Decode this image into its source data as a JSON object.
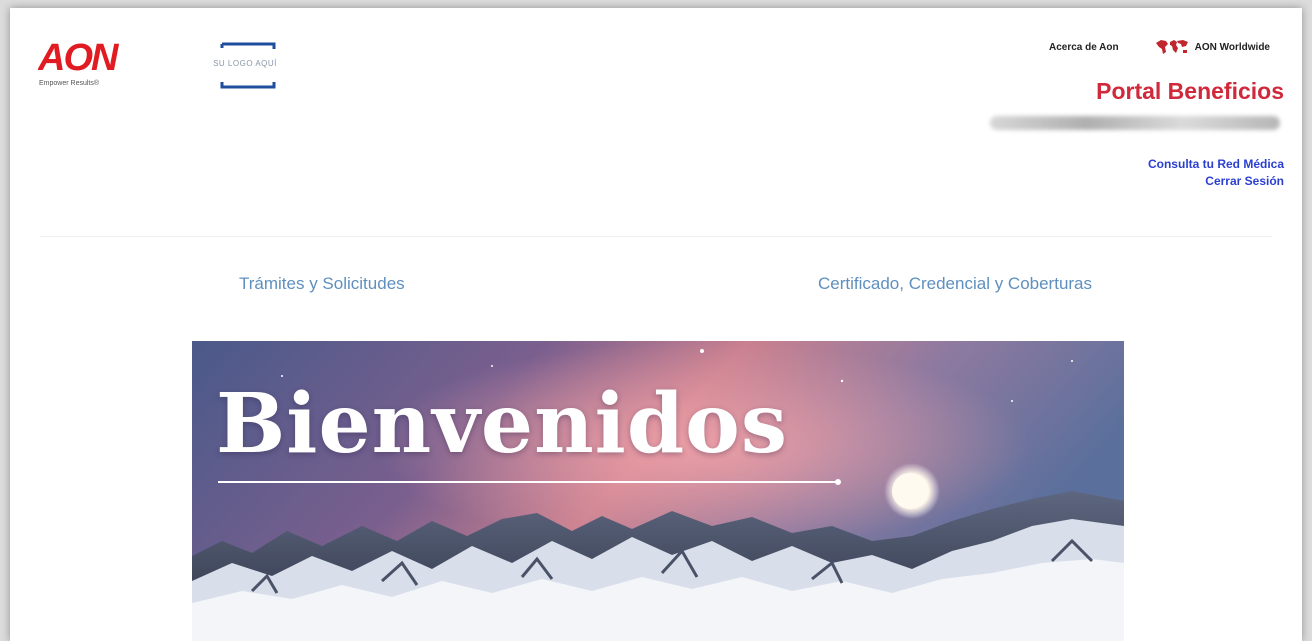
{
  "brand": {
    "logo_text": "AON",
    "tagline": "Empower Results®",
    "placeholder_logo": "SU LOGO AQUÍ",
    "colors": {
      "aon_red": "#e11b22",
      "title_red": "#d0293b",
      "link_blue": "#2b3fcf",
      "nav_blue": "#5f8fbf"
    }
  },
  "top_links": {
    "about": "Acerca de Aon",
    "worldwide": "AON Worldwide",
    "worldwide_icon": "world-map-icon"
  },
  "portal": {
    "title": "Portal Beneficios"
  },
  "account": {
    "network_link": "Consulta tu Red Médica",
    "logout_link": "Cerrar Sesión"
  },
  "nav": {
    "tramites": "Trámites y Solicitudes",
    "certificado": "Certificado, Credencial y Coberturas"
  },
  "banner": {
    "title": "Bienvenidos"
  }
}
